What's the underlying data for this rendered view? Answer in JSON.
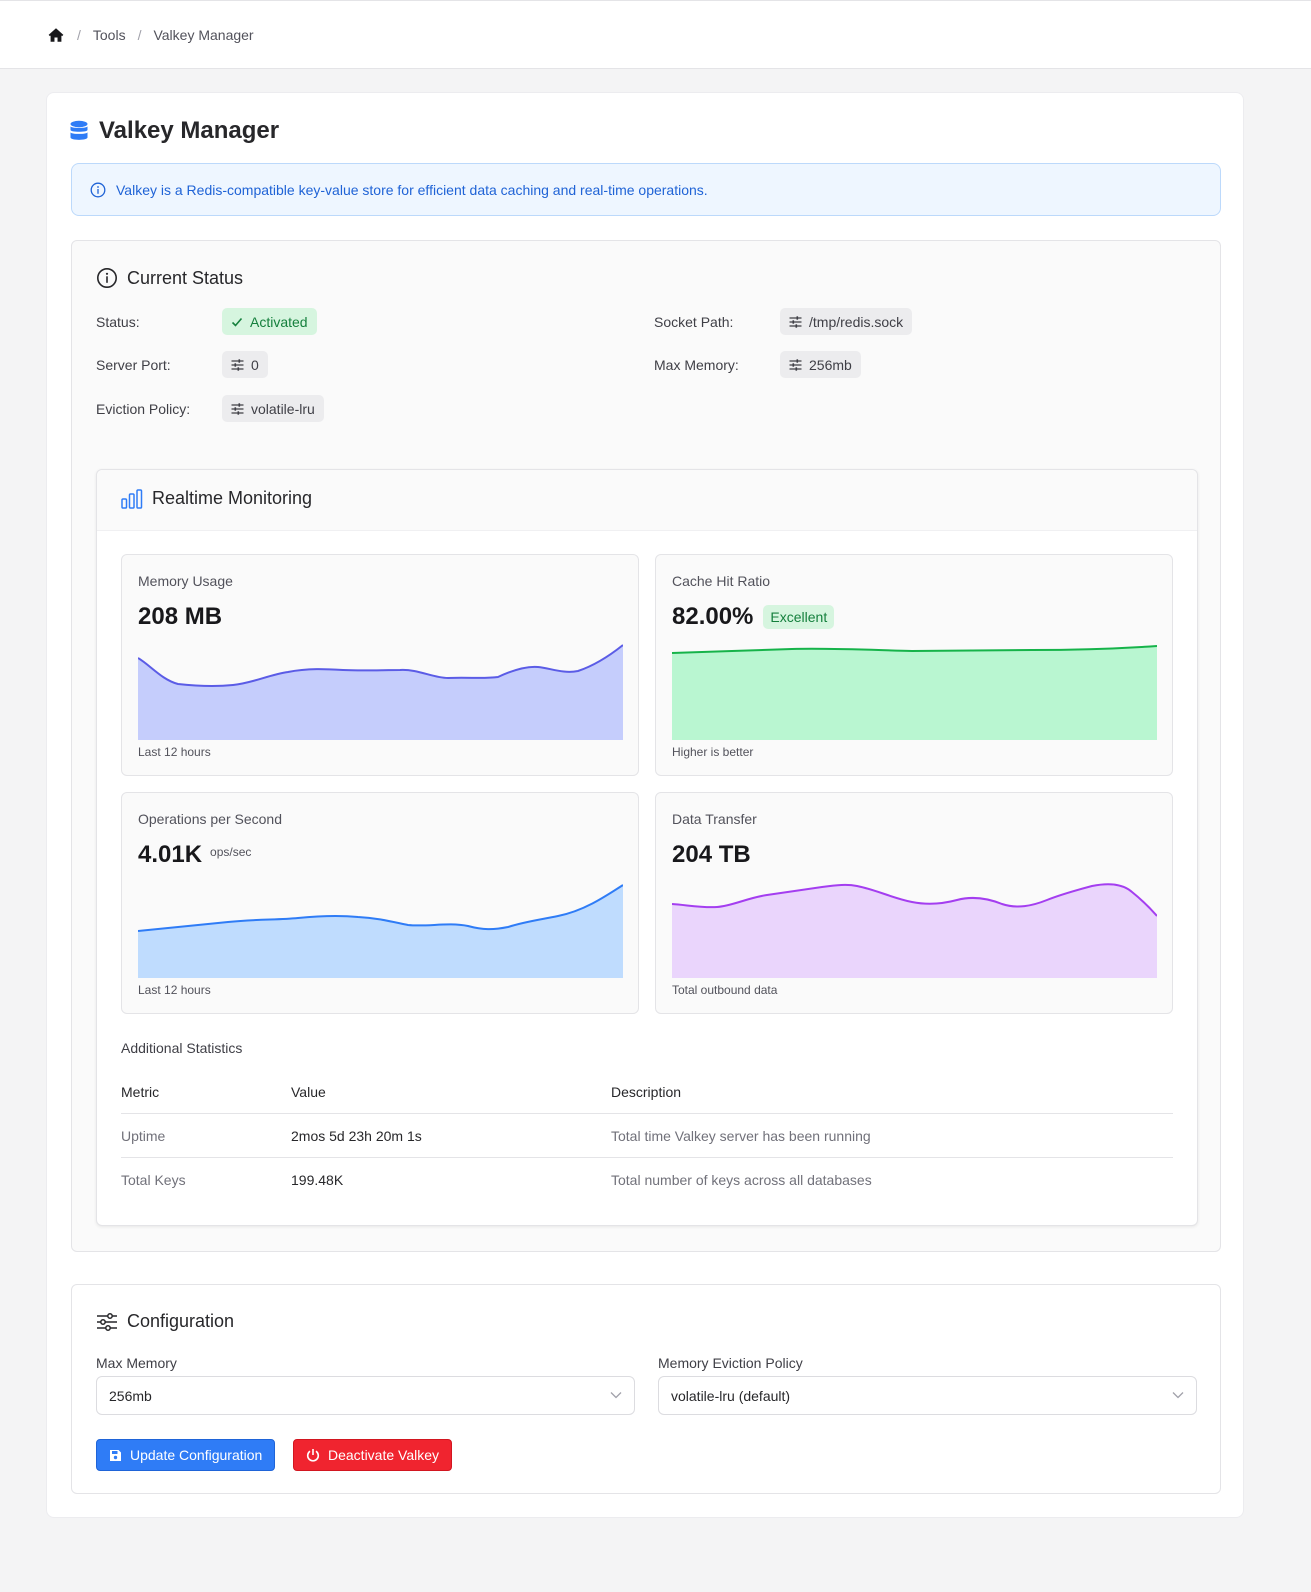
{
  "breadcrumb": {
    "items": [
      "Tools",
      "Valkey Manager"
    ]
  },
  "page": {
    "title": "Valkey Manager",
    "info": "Valkey is a Redis-compatible key-value store for efficient data caching and real-time operations."
  },
  "status": {
    "title": "Current Status",
    "status_label": "Status:",
    "status_value": "Activated",
    "port_label": "Server Port:",
    "port_value": "0",
    "eviction_label": "Eviction Policy:",
    "eviction_value": "volatile-lru",
    "socket_label": "Socket Path:",
    "socket_value": "/tmp/redis.sock",
    "maxmem_label": "Max Memory:",
    "maxmem_value": "256mb"
  },
  "monitoring": {
    "title": "Realtime Monitoring",
    "cards": [
      {
        "title": "Memory Usage",
        "value": "208 MB",
        "unit": "",
        "badge": "",
        "footer": "Last 12 hours",
        "stroke": "#5b5ce6",
        "fill": "#c5cdfc"
      },
      {
        "title": "Cache Hit Ratio",
        "value": "82.00%",
        "unit": "",
        "badge": "Excellent",
        "footer": "Higher is better",
        "stroke": "#16b34a",
        "fill": "#b9f6d1"
      },
      {
        "title": "Operations per Second",
        "value": "4.01K",
        "unit": "ops/sec",
        "badge": "",
        "footer": "Last 12 hours",
        "stroke": "#2f7cf6",
        "fill": "#bfdcfe"
      },
      {
        "title": "Data Transfer",
        "value": "204 TB",
        "unit": "",
        "badge": "",
        "footer": "Total outbound data",
        "stroke": "#a43ef0",
        "fill": "#ead5fc"
      }
    ]
  },
  "stats": {
    "title": "Additional Statistics",
    "headers": [
      "Metric",
      "Value",
      "Description"
    ],
    "rows": [
      {
        "metric": "Uptime",
        "value": "2mos 5d 23h 20m 1s",
        "description": "Total time Valkey server has been running"
      },
      {
        "metric": "Total Keys",
        "value": "199.48K",
        "description": "Total number of keys across all databases"
      }
    ]
  },
  "config": {
    "title": "Configuration",
    "max_memory_label": "Max Memory",
    "max_memory_value": "256mb",
    "eviction_label": "Memory Eviction Policy",
    "eviction_value": "volatile-lru (default)",
    "update_button": "Update Configuration",
    "deactivate_button": "Deactivate Valkey"
  }
}
